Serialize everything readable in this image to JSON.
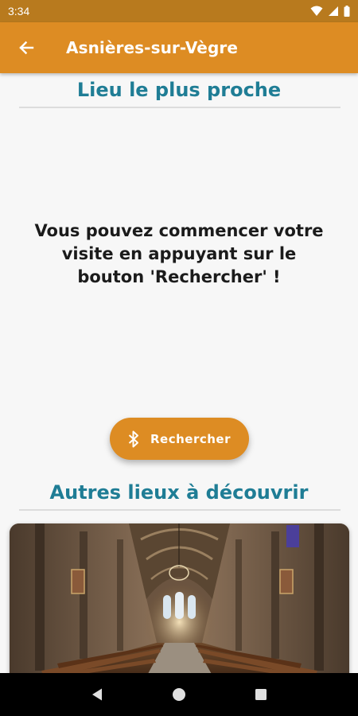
{
  "status_bar": {
    "time": "3:34"
  },
  "app_bar": {
    "title": "Asnières-sur-Vègre"
  },
  "nearest": {
    "title": "Lieu le plus proche",
    "message": "Vous pouvez commencer votre visite en appuyant sur le bouton 'Rechercher' !"
  },
  "search_button": {
    "label": "Rechercher",
    "icon": "bluetooth-icon"
  },
  "others": {
    "title": "Autres lieux à découvrir",
    "cards": [
      {
        "image": "church-interior-image"
      }
    ]
  },
  "nav": {
    "icons": [
      "back-triangle-icon",
      "home-circle-icon",
      "recents-square-icon"
    ]
  },
  "colors": {
    "accent": "#dd8c23",
    "status_bar": "#b87a1e",
    "title_teal": "#1f7d95",
    "text_dark": "#1b1b1b"
  }
}
